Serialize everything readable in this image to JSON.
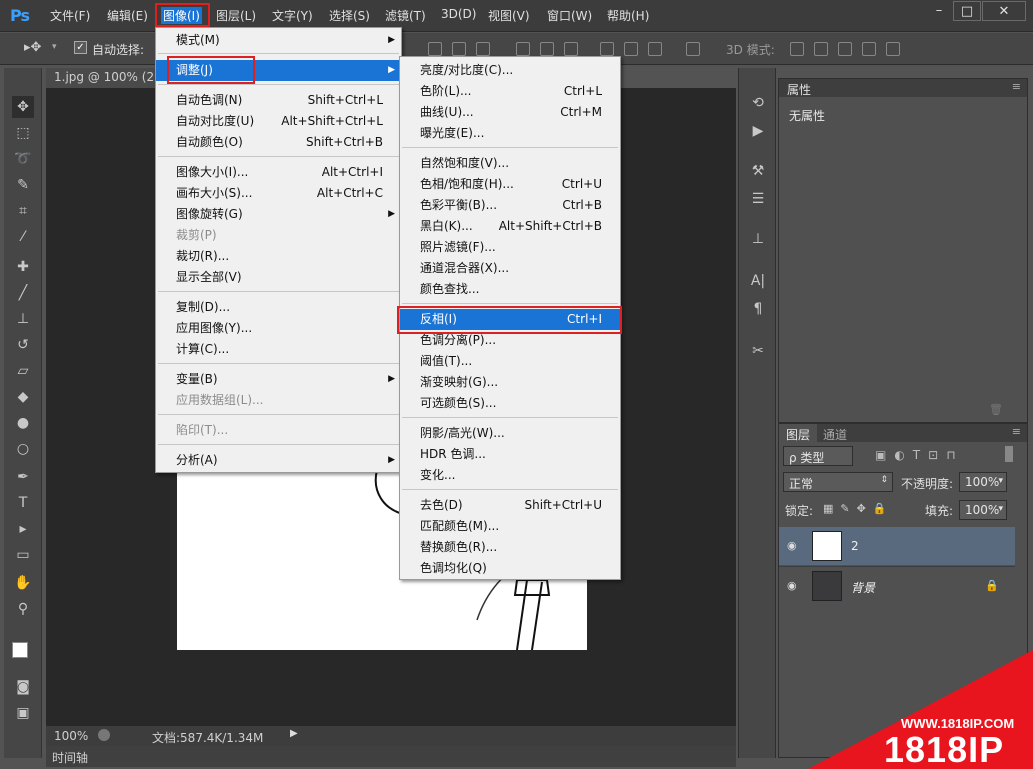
{
  "app": {
    "logo": "Ps"
  },
  "menubar": {
    "items": [
      "文件(F)",
      "编辑(E)",
      "图像(I)",
      "图层(L)",
      "文字(Y)",
      "选择(S)",
      "滤镜(T)",
      "3D(D)",
      "视图(V)",
      "窗口(W)",
      "帮助(H)"
    ],
    "active": "图像(I)",
    "window_controls": [
      "–",
      "□",
      "✕"
    ]
  },
  "options": {
    "auto_select": "自动选择:",
    "mode_3d": "3D 模式:"
  },
  "document": {
    "tab": "1.jpg @ 100% (2, R",
    "zoom": "100%",
    "doc_info": "文档:587.4K/1.34M",
    "timeline": "时间轴"
  },
  "image_menu": {
    "items": [
      {
        "label": "模式(M)",
        "shortcut": "",
        "submenu": true
      },
      {
        "label": "调整(J)",
        "shortcut": "",
        "submenu": true,
        "highlight": true
      },
      {
        "label": "自动色调(N)",
        "shortcut": "Shift+Ctrl+L"
      },
      {
        "label": "自动对比度(U)",
        "shortcut": "Alt+Shift+Ctrl+L"
      },
      {
        "label": "自动颜色(O)",
        "shortcut": "Shift+Ctrl+B"
      },
      {
        "label": "图像大小(I)...",
        "shortcut": "Alt+Ctrl+I"
      },
      {
        "label": "画布大小(S)...",
        "shortcut": "Alt+Ctrl+C"
      },
      {
        "label": "图像旋转(G)",
        "shortcut": "",
        "submenu": true
      },
      {
        "label": "裁剪(P)",
        "shortcut": "",
        "disabled": true
      },
      {
        "label": "裁切(R)...",
        "shortcut": ""
      },
      {
        "label": "显示全部(V)",
        "shortcut": ""
      },
      {
        "label": "复制(D)...",
        "shortcut": ""
      },
      {
        "label": "应用图像(Y)...",
        "shortcut": ""
      },
      {
        "label": "计算(C)...",
        "shortcut": ""
      },
      {
        "label": "变量(B)",
        "shortcut": "",
        "submenu": true
      },
      {
        "label": "应用数据组(L)...",
        "shortcut": "",
        "disabled": true
      },
      {
        "label": "陷印(T)...",
        "shortcut": "",
        "disabled": true
      },
      {
        "label": "分析(A)",
        "shortcut": "",
        "submenu": true
      }
    ]
  },
  "adjust_menu": {
    "items": [
      {
        "label": "亮度/对比度(C)...",
        "shortcut": ""
      },
      {
        "label": "色阶(L)...",
        "shortcut": "Ctrl+L"
      },
      {
        "label": "曲线(U)...",
        "shortcut": "Ctrl+M"
      },
      {
        "label": "曝光度(E)...",
        "shortcut": ""
      },
      {
        "label": "自然饱和度(V)...",
        "shortcut": ""
      },
      {
        "label": "色相/饱和度(H)...",
        "shortcut": "Ctrl+U"
      },
      {
        "label": "色彩平衡(B)...",
        "shortcut": "Ctrl+B"
      },
      {
        "label": "黑白(K)...",
        "shortcut": "Alt+Shift+Ctrl+B"
      },
      {
        "label": "照片滤镜(F)...",
        "shortcut": ""
      },
      {
        "label": "通道混合器(X)...",
        "shortcut": ""
      },
      {
        "label": "颜色查找...",
        "shortcut": ""
      },
      {
        "label": "反相(I)",
        "shortcut": "Ctrl+I",
        "highlight": true
      },
      {
        "label": "色调分离(P)...",
        "shortcut": ""
      },
      {
        "label": "阈值(T)...",
        "shortcut": ""
      },
      {
        "label": "渐变映射(G)...",
        "shortcut": ""
      },
      {
        "label": "可选颜色(S)...",
        "shortcut": ""
      },
      {
        "label": "阴影/高光(W)...",
        "shortcut": ""
      },
      {
        "label": "HDR 色调...",
        "shortcut": ""
      },
      {
        "label": "变化...",
        "shortcut": ""
      },
      {
        "label": "去色(D)",
        "shortcut": "Shift+Ctrl+U"
      },
      {
        "label": "匹配颜色(M)...",
        "shortcut": ""
      },
      {
        "label": "替换颜色(R)...",
        "shortcut": ""
      },
      {
        "label": "色调均化(Q)",
        "shortcut": ""
      }
    ]
  },
  "properties": {
    "title": "属性",
    "empty": "无属性"
  },
  "layers": {
    "tabs": [
      "图层",
      "通道"
    ],
    "filter": "ρ 类型",
    "blend": "正常",
    "opacity_label": "不透明度:",
    "opacity": "100%",
    "lock_label": "锁定:",
    "fill_label": "填充:",
    "fill": "100%",
    "list": [
      {
        "name": "2",
        "selected": true
      },
      {
        "name": "背景",
        "locked": true
      }
    ]
  },
  "watermark": {
    "url": "WWW.1818IP.COM",
    "brand": "1818IP"
  }
}
